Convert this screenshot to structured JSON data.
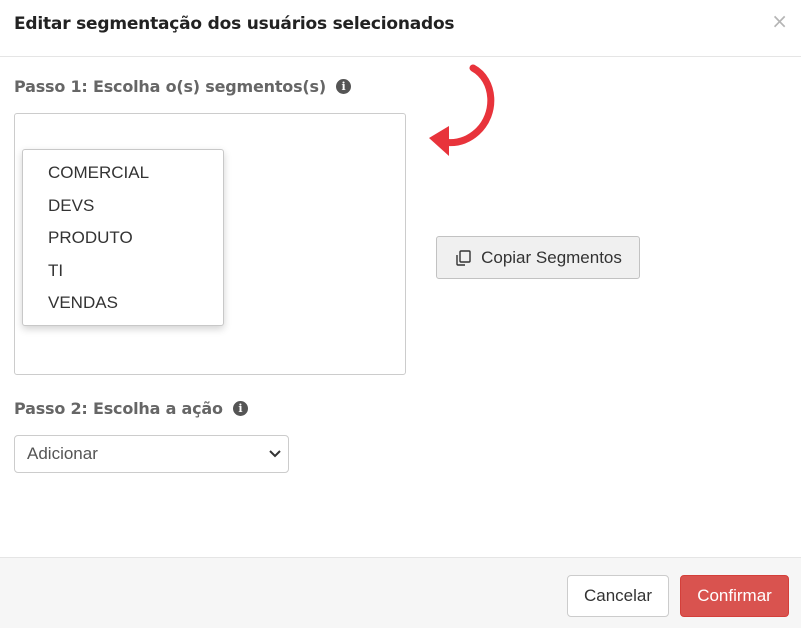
{
  "modal": {
    "title": "Editar segmentação dos usuários selecionados",
    "close_symbol": "×"
  },
  "step1": {
    "label": "Passo 1: Escolha o(s) segmentos(s)",
    "info_icon": "info-icon",
    "segments": [
      "COMERCIAL",
      "DEVS",
      "PRODUTO",
      "TI",
      "VENDAS"
    ]
  },
  "copy_button": {
    "label": "Copiar Segmentos",
    "icon": "copy-icon"
  },
  "step2": {
    "label": "Passo 2: Escolha a ação",
    "info_icon": "info-icon",
    "select_value": "Adicionar"
  },
  "footer": {
    "cancel_label": "Cancelar",
    "confirm_label": "Confirmar"
  },
  "colors": {
    "confirm": "#d9534f",
    "annotation_arrow": "#e8333b"
  }
}
